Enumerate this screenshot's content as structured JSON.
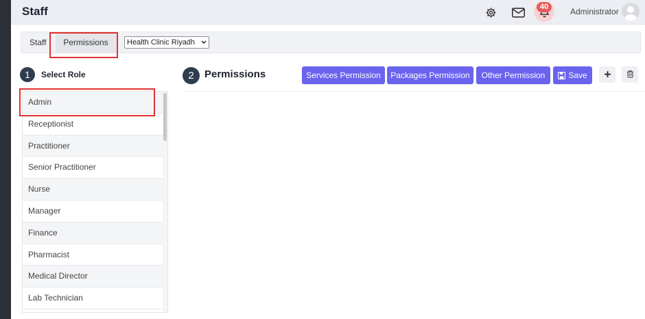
{
  "header": {
    "title": "Staff",
    "notification_count": "40",
    "user_name": "Administrator",
    "icons": [
      "gear-icon",
      "mail-icon",
      "bell-icon",
      "avatar"
    ]
  },
  "tabs": {
    "staff_label": "Staff",
    "permissions_label": "Permissions"
  },
  "clinic_select": {
    "selected": "Health Clinic Riyadh"
  },
  "step1": {
    "number": "1",
    "label": "Select Role"
  },
  "step2": {
    "number": "2",
    "label": "Permissions"
  },
  "toolbar": {
    "services_label": "Services Permission",
    "packages_label": "Packages Permission",
    "other_label": "Other Permission",
    "save_label": "Save",
    "add_icon": "plus-icon",
    "delete_icon": "trash-icon"
  },
  "roles": [
    "Admin",
    "Receptionist",
    "Practitioner",
    "Senior Practitioner",
    "Nurse",
    "Manager",
    "Finance",
    "Pharmacist",
    "Medical Director",
    "Lab Technician"
  ],
  "colors": {
    "primary_button": "#6a63ee",
    "highlight": "#e0302f",
    "badge": "#e85c5c",
    "step_circle": "#2f3d4e"
  }
}
